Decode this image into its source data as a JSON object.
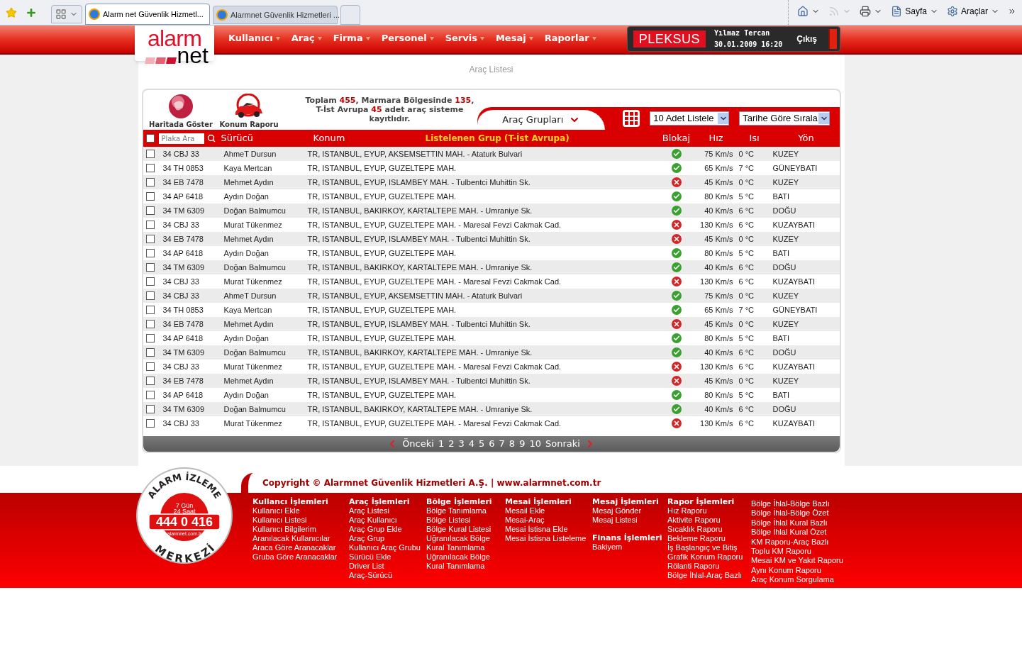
{
  "browser": {
    "tabs": [
      {
        "title": "Alarm net  Güvenlik Hizmetl...",
        "selected": true
      },
      {
        "title": "Alarmnet Güvenlik Hizmetleri ...",
        "selected": false
      }
    ],
    "toolbar": [
      {
        "kind": "home",
        "disabled": false
      },
      {
        "kind": "feed",
        "disabled": true
      },
      {
        "kind": "print",
        "disabled": false
      },
      {
        "kind": "page",
        "label": "Sayfa",
        "disabled": false
      },
      {
        "kind": "tools",
        "label": "Araçlar",
        "disabled": false
      }
    ]
  },
  "header": {
    "logo": {
      "line1": "alarm",
      "line2": "net"
    },
    "menu": [
      "Kullanıcı",
      "Araç",
      "Firma",
      "Personel",
      "Servis",
      "Mesaj",
      "Raporlar"
    ],
    "brand": "PLEKSUS",
    "user": "Yılmaz Tercan",
    "datetime": "30.01.2009 16:20",
    "logout": "Çıkış"
  },
  "page_title": "Araç Listesi",
  "actions": [
    {
      "kind": "globe",
      "label": "Haritada Göster"
    },
    {
      "kind": "car",
      "label": "Konum Raporu"
    }
  ],
  "summary": "Toplam **455**, Marmara Bölgesinde **135**, T-İst Avrupa **45** adet araç sisteme kayıtlıdır.",
  "group_tab": "Araç Grupları",
  "page_size": "10 Adet Listele",
  "sort": "Tarihe Göre Sırala",
  "table": {
    "plate_search": {
      "placeholder": "Plaka Ara"
    },
    "select_all_checked": false,
    "columns": [
      "Sürücü",
      "Konum",
      "Blokaj",
      "Hız",
      "Isı",
      "Yön"
    ],
    "group_label": "Listelenen Grup (T-İst Avrupa)",
    "rows": [
      {
        "checked": false,
        "plate": "34 CBJ 33",
        "driver": "AhmeT Dursun",
        "location": "TR, ISTANBUL, EYUP, AKSEMSETTIN MAH. - Ataturk Bulvari",
        "ok": true,
        "speed": "75 Km/s",
        "temp": "0 °C",
        "direction": "KUZEY"
      },
      {
        "checked": false,
        "plate": "34 TH 0853",
        "driver": "Kaya Mertcan",
        "location": "TR, ISTANBUL, EYUP, GUZELTEPE MAH.",
        "ok": true,
        "speed": "65 Km/s",
        "temp": "7 °C",
        "direction": "GÜNEYBATI"
      },
      {
        "checked": false,
        "plate": "34 EB 7478",
        "driver": "Mehmet Aydın",
        "location": "TR, ISTANBUL, EYUP, ISLAMBEY MAH. - Tulbentci Muhittin Sk.",
        "ok": false,
        "speed": "45 Km/s",
        "temp": "0 °C",
        "direction": "KUZEY"
      },
      {
        "checked": false,
        "plate": "34 AP 6418",
        "driver": "Aydın Doğan",
        "location": "TR, ISTANBUL, EYUP, GUZELTEPE MAH.",
        "ok": true,
        "speed": "80 Km/s",
        "temp": "5 °C",
        "direction": "BATI"
      },
      {
        "checked": false,
        "plate": "34 TM 6309",
        "driver": "Doğan Balmumcu",
        "location": "TR, ISTANBUL, BAKIRKOY, KARTALTEPE MAH. - Umraniye Sk.",
        "ok": true,
        "speed": "40 Km/s",
        "temp": "6 °C",
        "direction": "DOĞU"
      },
      {
        "checked": false,
        "plate": "34 CBJ 33",
        "driver": "Murat Tükenmez",
        "location": "TR, ISTANBUL, EYUP, GUZELTEPE MAH. - Maresal Fevzi Cakmak Cad.",
        "ok": false,
        "speed": "130 Km/s",
        "temp": "6 °C",
        "direction": "KUZAYBATI"
      },
      {
        "checked": false,
        "plate": "34 EB 7478",
        "driver": "Mehmet Aydın",
        "location": "TR, ISTANBUL, EYUP, ISLAMBEY MAH. - Tulbentci Muhittin Sk.",
        "ok": false,
        "speed": "45 Km/s",
        "temp": "0 °C",
        "direction": "KUZEY"
      },
      {
        "checked": false,
        "plate": "34 AP 6418",
        "driver": "Aydın Doğan",
        "location": "TR, ISTANBUL, EYUP, GUZELTEPE MAH.",
        "ok": true,
        "speed": "80 Km/s",
        "temp": "5 °C",
        "direction": "BATI"
      },
      {
        "checked": false,
        "plate": "34 TM 6309",
        "driver": "Doğan Balmumcu",
        "location": "TR, ISTANBUL, BAKIRKOY, KARTALTEPE MAH. - Umraniye Sk.",
        "ok": true,
        "speed": "40 Km/s",
        "temp": "6 °C",
        "direction": "DOĞU"
      },
      {
        "checked": false,
        "plate": "34 CBJ 33",
        "driver": "Murat Tükenmez",
        "location": "TR, ISTANBUL, EYUP, GUZELTEPE MAH. - Maresal Fevzi Cakmak Cad.",
        "ok": false,
        "speed": "130 Km/s",
        "temp": "6 °C",
        "direction": "KUZAYBATI"
      },
      {
        "checked": false,
        "plate": "34 CBJ 33",
        "driver": "AhmeT Dursun",
        "location": "TR, ISTANBUL, EYUP, AKSEMSETTIN MAH. - Ataturk Bulvari",
        "ok": true,
        "speed": "75 Km/s",
        "temp": "0 °C",
        "direction": "KUZEY"
      },
      {
        "checked": false,
        "plate": "34 TH 0853",
        "driver": "Kaya Mertcan",
        "location": "TR, ISTANBUL, EYUP, GUZELTEPE MAH.",
        "ok": true,
        "speed": "65 Km/s",
        "temp": "7 °C",
        "direction": "GÜNEYBATI"
      },
      {
        "checked": false,
        "plate": "34 EB 7478",
        "driver": "Mehmet Aydın",
        "location": "TR, ISTANBUL, EYUP, ISLAMBEY MAH. - Tulbentci Muhittin Sk.",
        "ok": false,
        "speed": "45 Km/s",
        "temp": "0 °C",
        "direction": "KUZEY"
      },
      {
        "checked": false,
        "plate": "34 AP 6418",
        "driver": "Aydın Doğan",
        "location": "TR, ISTANBUL, EYUP, GUZELTEPE MAH.",
        "ok": true,
        "speed": "80 Km/s",
        "temp": "5 °C",
        "direction": "BATI"
      },
      {
        "checked": false,
        "plate": "34 TM 6309",
        "driver": "Doğan Balmumcu",
        "location": "TR, ISTANBUL, BAKIRKOY, KARTALTEPE MAH. - Umraniye Sk.",
        "ok": true,
        "speed": "40 Km/s",
        "temp": "6 °C",
        "direction": "DOĞU"
      },
      {
        "checked": false,
        "plate": "34 CBJ 33",
        "driver": "Murat Tükenmez",
        "location": "TR, ISTANBUL, EYUP, GUZELTEPE MAH. - Maresal Fevzi Cakmak Cad.",
        "ok": false,
        "speed": "130 Km/s",
        "temp": "6 °C",
        "direction": "KUZAYBATI"
      },
      {
        "checked": false,
        "plate": "34 EB 7478",
        "driver": "Mehmet Aydın",
        "location": "TR, ISTANBUL, EYUP, ISLAMBEY MAH. - Tulbentci Muhittin Sk.",
        "ok": false,
        "speed": "45 Km/s",
        "temp": "0 °C",
        "direction": "KUZEY"
      },
      {
        "checked": false,
        "plate": "34 AP 6418",
        "driver": "Aydın Doğan",
        "location": "TR, ISTANBUL, EYUP, GUZELTEPE MAH.",
        "ok": true,
        "speed": "80 Km/s",
        "temp": "5 °C",
        "direction": "BATI"
      },
      {
        "checked": false,
        "plate": "34 TM 6309",
        "driver": "Doğan Balmumcu",
        "location": "TR, ISTANBUL, BAKIRKOY, KARTALTEPE MAH. - Umraniye Sk.",
        "ok": true,
        "speed": "40 Km/s",
        "temp": "6 °C",
        "direction": "DOĞU"
      },
      {
        "checked": false,
        "plate": "34 CBJ 33",
        "driver": "Murat Tükenmez",
        "location": "TR, ISTANBUL, EYUP, GUZELTEPE MAH. - Maresal Fevzi Cakmak Cad.",
        "ok": false,
        "speed": "130 Km/s",
        "temp": "6 °C",
        "direction": "KUZAYBATI"
      }
    ]
  },
  "pagination": {
    "previous": "Önceki",
    "pages": [
      "1",
      "2",
      "3",
      "4",
      "5",
      "6",
      "7",
      "8",
      "9",
      "10"
    ],
    "next": "Sonraki"
  },
  "footer": {
    "badge": {
      "top": "ALARM İZLEME",
      "bottom": "MERKEZİ",
      "line1": "7 Gün",
      "line2": "24 Saat",
      "phone": "444 0 416",
      "site": "alarmnet.com.tr"
    },
    "copyright": "Copyright © Alarmnet Güvenlik Hizmetleri A.Ş. | www.alarmnet.com.tr",
    "columns": [
      {
        "sections": [
          {
            "title": "Kullancı İşlemleri",
            "items": [
              "Kullanıcı Ekle",
              "Kullanıcı Listesi",
              "Kullanıcı Bilgilerim",
              "Aranılacak Kullanıcılar",
              "Araca Göre Aranacaklar",
              "Gruba Göre Aranacaklar"
            ]
          }
        ]
      },
      {
        "sections": [
          {
            "title": "Araç İşlemleri",
            "items": [
              "Araç Listesi",
              "Araç Kullanıcı",
              "Araç Grup Ekle",
              "Araç Grup",
              "Kullanıcı Araç Grubu",
              "Sürücü Ekle",
              "Driver List",
              "Araç-Sürücü"
            ]
          }
        ]
      },
      {
        "sections": [
          {
            "title": "Bölge İşlemleri",
            "items": [
              "Bölge Tanımlama",
              "Bölge Listesi",
              "Bölge Kural Listesi",
              "Uğranılacak Bölge",
              "Kural Tanımlama",
              "Uğranılacak Bölge",
              "Kural Tanımlama"
            ]
          }
        ]
      },
      {
        "sections": [
          {
            "title": "Mesai İşlemleri",
            "items": [
              "Mesail Ekle",
              "Mesai-Araç",
              "Mesai İstisna Ekle",
              "Mesai İstisna Listeleme"
            ]
          }
        ]
      },
      {
        "sections": [
          {
            "title": "Mesaj İşlemleri",
            "items": [
              "Mesaj Gönder",
              "Mesaj Listesi"
            ]
          },
          {
            "title": "Finans İşlemleri",
            "items": [
              "Bakiyem"
            ]
          }
        ]
      },
      {
        "sections": [
          {
            "title": "Rapor İşlemleri",
            "items": [
              "Hız Raporu",
              "Aktivite Raporu",
              "Sıcaklık Raporu",
              "Bekleme Raporu",
              "İş Başlangıç ve Bitiş",
              "Grafik Konum Raporu",
              "Rölanti Raporu",
              "Bölge İhlal-Araç Bazlı"
            ]
          }
        ]
      },
      {
        "sections": [
          {
            "items": [
              "Bölge İhlal-Bölge Bazlı",
              "Bölge İhlal-Bölge Özet",
              "Bölge İhlal Kural Bazlı",
              "Bölge İhlal Kural Özet",
              "KM Raporu-Araç Bazlı",
              "Toplu KM Raporu",
              "Mesai KM ve Yakıt Raporu",
              "Aynı Konum Raporu",
              "Araç Konum Sorgulama"
            ]
          }
        ]
      }
    ]
  }
}
